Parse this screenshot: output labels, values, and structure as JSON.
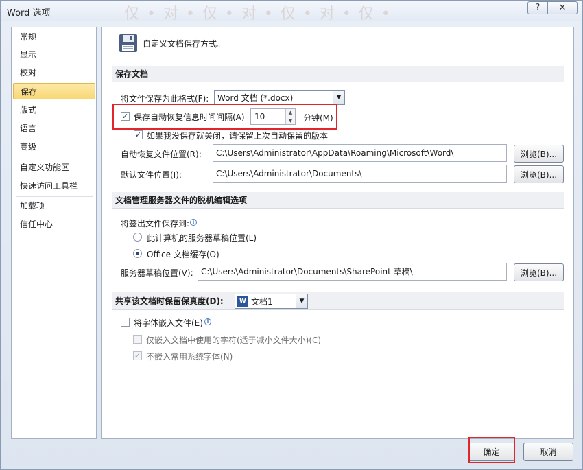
{
  "window": {
    "title": "Word 选项",
    "watermark": "仅 • 对 • 仅 • 对 • 仅 • 对 • 仅 •",
    "help_label": "?",
    "close_label": "✕"
  },
  "nav": {
    "items": [
      {
        "label": "常规"
      },
      {
        "label": "显示"
      },
      {
        "label": "校对"
      },
      {
        "label": "保存"
      },
      {
        "label": "版式"
      },
      {
        "label": "语言"
      },
      {
        "label": "高级"
      },
      {
        "label": "自定义功能区"
      },
      {
        "label": "快速访问工具栏"
      },
      {
        "label": "加载项"
      },
      {
        "label": "信任中心"
      }
    ],
    "selected": "保存"
  },
  "header": {
    "text": "自定义文档保存方式。"
  },
  "save_docs": {
    "section_title": "保存文档",
    "format_label": "将文件保存为此格式(F):",
    "format_value": "Word 文档 (*.docx)",
    "autorecover_label": "保存自动恢复信息时间间隔(A)",
    "autorecover_checked": true,
    "autorecover_minutes": "10",
    "minutes_label": "分钟(M)",
    "keep_last_label": "如果我没保存就关闭，请保留上次自动保留的版本",
    "keep_last_checked": true,
    "autorecover_location_label": "自动恢复文件位置(R):",
    "autorecover_location_value": "C:\\Users\\Administrator\\AppData\\Roaming\\Microsoft\\Word\\",
    "default_location_label": "默认文件位置(I):",
    "default_location_value": "C:\\Users\\Administrator\\Documents\\",
    "browse_label": "浏览(B)..."
  },
  "offline": {
    "section_title": "文档管理服务器文件的脱机编辑选项",
    "checkout_label": "将签出文件保存到:",
    "option_server_label": "此计算机的服务器草稿位置(L)",
    "option_cache_label": "Office 文档缓存(O)",
    "selected_option": "Office 文档缓存(O)",
    "drafts_location_label": "服务器草稿位置(V):",
    "drafts_location_value": "C:\\Users\\Administrator\\Documents\\SharePoint 草稿\\",
    "browse_label": "浏览(B)..."
  },
  "fidelity": {
    "section_title": "共享该文档时保留保真度(D):",
    "document_value": "文档1",
    "embed_fonts_label": "将字体嵌入文件(E)",
    "embed_fonts_checked": false,
    "embed_used_only_label": "仅嵌入文档中使用的字符(适于减小文件大小)(C)",
    "embed_used_only_checked": false,
    "no_common_fonts_label": "不嵌入常用系统字体(N)",
    "no_common_fonts_checked": true
  },
  "footer": {
    "ok_label": "确定",
    "cancel_label": "取消"
  },
  "colors": {
    "highlight_red": "#e0262b",
    "selected_nav": "#f8d775",
    "section_bg": "#eef0f3"
  }
}
